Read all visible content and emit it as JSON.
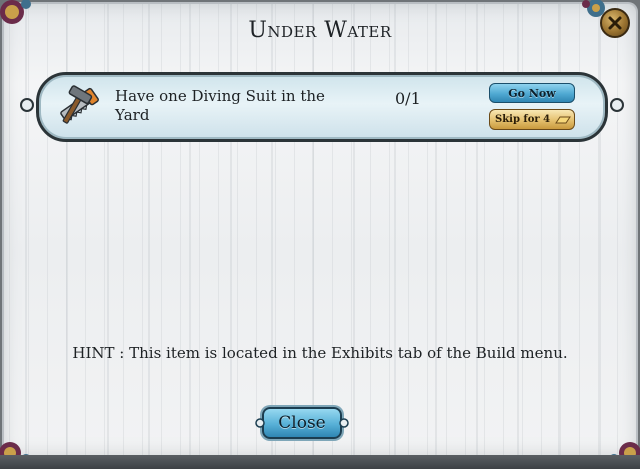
{
  "dialog": {
    "title": "Under Water",
    "close_icon": "close-x-icon"
  },
  "task": {
    "icon": "tools-icon",
    "text": "Have one Diving Suit in the Yard",
    "progress": "0/1",
    "go_label": "Go Now",
    "skip_label": "Skip for 4",
    "skip_icon": "gold-bar-icon"
  },
  "hint": "HINT : This item is located in the Exhibits tab of the Build menu.",
  "footer": {
    "close_label": "Close"
  },
  "colors": {
    "accent_blue": "#4fa9d2",
    "gold": "#e4c06e",
    "panel": "#eceef0"
  }
}
